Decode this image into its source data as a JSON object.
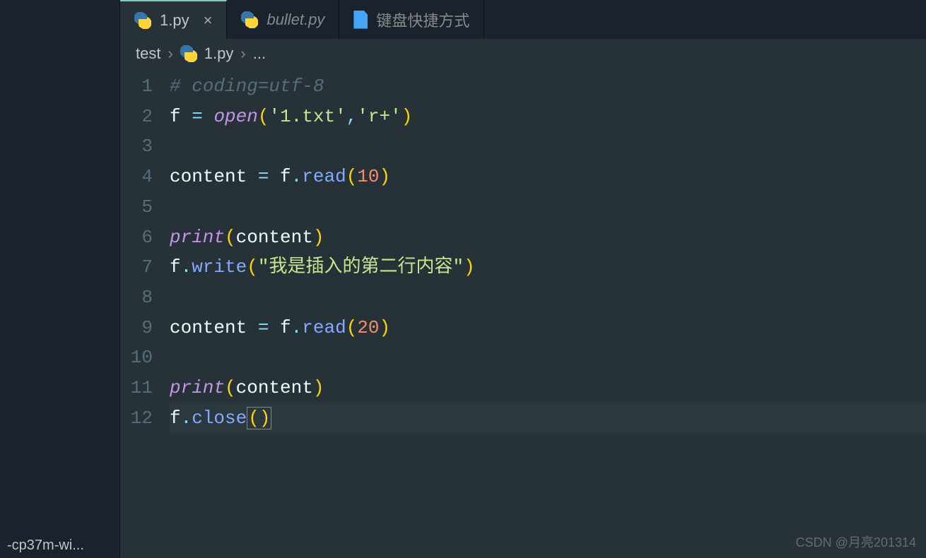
{
  "sidebar": {
    "truncated_item": "-cp37m-wi..."
  },
  "tabs": [
    {
      "label": "1.py",
      "icon": "python",
      "active": true,
      "has_close": true
    },
    {
      "label": "bullet.py",
      "icon": "python",
      "active": false,
      "italic": true
    },
    {
      "label": "键盘快捷方式",
      "icon": "file",
      "active": false,
      "italic": false
    }
  ],
  "breadcrumb": {
    "folder": "test",
    "file": "1.py",
    "symbol": "..."
  },
  "code": {
    "lines": [
      {
        "n": 1,
        "tokens": [
          [
            "comment",
            "# coding=utf-8"
          ]
        ]
      },
      {
        "n": 2,
        "tokens": [
          [
            "var",
            "f "
          ],
          [
            "op",
            "= "
          ],
          [
            "builtin",
            "open"
          ],
          [
            "paren",
            "("
          ],
          [
            "str",
            "'1.txt'"
          ],
          [
            "op",
            ","
          ],
          [
            "str",
            "'r+'"
          ],
          [
            "paren",
            ")"
          ]
        ]
      },
      {
        "n": 3,
        "tokens": []
      },
      {
        "n": 4,
        "tokens": [
          [
            "var",
            "content "
          ],
          [
            "op",
            "= "
          ],
          [
            "var",
            "f"
          ],
          [
            "op",
            "."
          ],
          [
            "func",
            "read"
          ],
          [
            "paren",
            "("
          ],
          [
            "num",
            "10"
          ],
          [
            "paren",
            ")"
          ]
        ]
      },
      {
        "n": 5,
        "tokens": []
      },
      {
        "n": 6,
        "tokens": [
          [
            "builtin",
            "print"
          ],
          [
            "paren",
            "("
          ],
          [
            "var",
            "content"
          ],
          [
            "paren",
            ")"
          ]
        ]
      },
      {
        "n": 7,
        "tokens": [
          [
            "var",
            "f"
          ],
          [
            "op",
            "."
          ],
          [
            "func",
            "write"
          ],
          [
            "paren",
            "("
          ],
          [
            "str",
            "\"我是插入的第二行内容\""
          ],
          [
            "paren",
            ")"
          ]
        ]
      },
      {
        "n": 8,
        "tokens": []
      },
      {
        "n": 9,
        "tokens": [
          [
            "var",
            "content "
          ],
          [
            "op",
            "= "
          ],
          [
            "var",
            "f"
          ],
          [
            "op",
            "."
          ],
          [
            "func",
            "read"
          ],
          [
            "paren",
            "("
          ],
          [
            "num",
            "20"
          ],
          [
            "paren",
            ")"
          ]
        ]
      },
      {
        "n": 10,
        "tokens": []
      },
      {
        "n": 11,
        "tokens": [
          [
            "builtin",
            "print"
          ],
          [
            "paren",
            "("
          ],
          [
            "var",
            "content"
          ],
          [
            "paren",
            ")"
          ]
        ]
      },
      {
        "n": 12,
        "tokens": [
          [
            "var",
            "f"
          ],
          [
            "op",
            "."
          ],
          [
            "func",
            "close"
          ],
          [
            "paren-cursor",
            "()"
          ]
        ],
        "current": true
      }
    ]
  },
  "watermark": "CSDN @月亮201314"
}
